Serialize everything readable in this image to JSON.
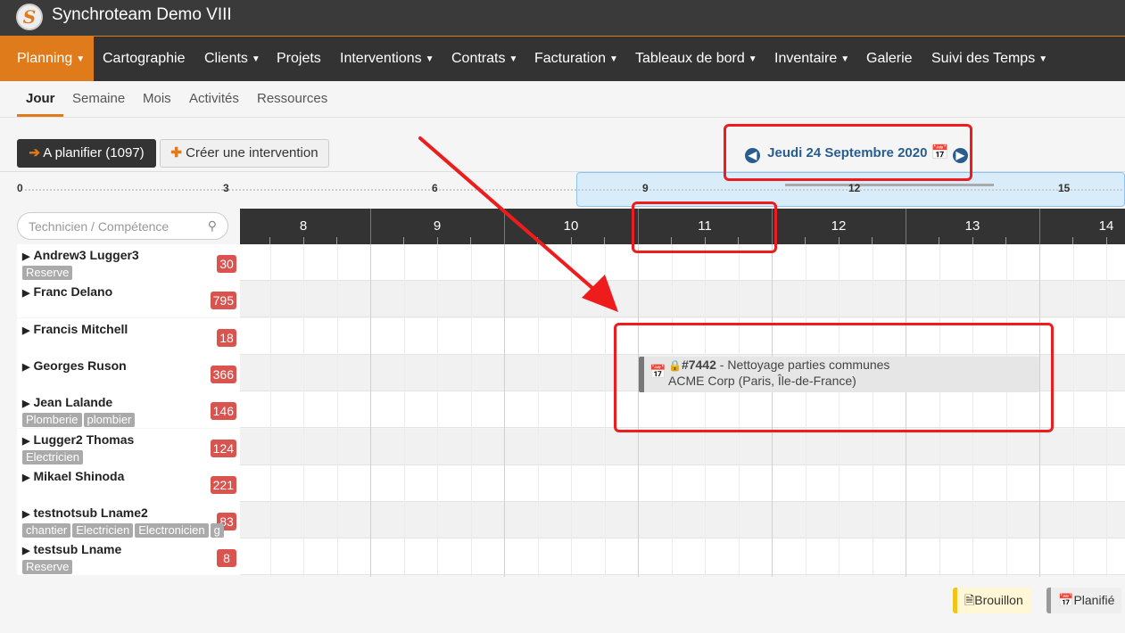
{
  "app": {
    "title": "Synchroteam Demo VIII",
    "logo_letter": "S"
  },
  "menu": [
    {
      "label": "Planning",
      "dropdown": true,
      "active": true
    },
    {
      "label": "Cartographie",
      "dropdown": false
    },
    {
      "label": "Clients",
      "dropdown": true
    },
    {
      "label": "Projets",
      "dropdown": false
    },
    {
      "label": "Interventions",
      "dropdown": true
    },
    {
      "label": "Contrats",
      "dropdown": true
    },
    {
      "label": "Facturation",
      "dropdown": true
    },
    {
      "label": "Tableaux de bord",
      "dropdown": true
    },
    {
      "label": "Inventaire",
      "dropdown": true
    },
    {
      "label": "Galerie",
      "dropdown": false
    },
    {
      "label": "Suivi des Temps",
      "dropdown": true
    }
  ],
  "subtabs": [
    "Jour",
    "Semaine",
    "Mois",
    "Activités",
    "Ressources"
  ],
  "toolbar": {
    "to_plan_label": "A planifier (1097)",
    "create_label": "Créer une intervention"
  },
  "date_nav": {
    "date_label": "Jeudi 24 Septembre 2020"
  },
  "ruler": {
    "labels": [
      "0",
      "3",
      "6",
      "9",
      "12",
      "15"
    ]
  },
  "search": {
    "placeholder": "Technicien / Compétence",
    "value": ""
  },
  "hours": [
    "8",
    "9",
    "10",
    "11",
    "12",
    "13",
    "14"
  ],
  "resources": [
    {
      "name": "Andrew3 Lugger3",
      "count": "30",
      "tags": [
        "Reserve"
      ]
    },
    {
      "name": "Franc Delano",
      "count": "795",
      "tags": []
    },
    {
      "name": "Francis Mitchell",
      "count": "18",
      "tags": []
    },
    {
      "name": "Georges Ruson",
      "count": "366",
      "tags": []
    },
    {
      "name": "Jean Lalande",
      "count": "146",
      "tags": [
        "Plomberie",
        "plombier"
      ]
    },
    {
      "name": "Lugger2 Thomas",
      "count": "124",
      "tags": [
        "Electricien"
      ]
    },
    {
      "name": "Mikael Shinoda",
      "count": "221",
      "tags": []
    },
    {
      "name": "testnotsub Lname2",
      "count": "83",
      "tags": [
        "chantier",
        "Electricien",
        "Electronicien",
        "g"
      ]
    },
    {
      "name": "testsub Lname",
      "count": "8",
      "tags": [
        "Reserve"
      ]
    }
  ],
  "event": {
    "number": "#7442",
    "title": " - Nettoyage parties communes",
    "client": "ACME Corp (Paris, Île-de-France)"
  },
  "legend": {
    "draft": "Brouillon",
    "planned": "Planifié"
  },
  "colors": {
    "accent": "#e07b1c",
    "nav_blue": "#2a5d8f",
    "badge_red": "#d9534f",
    "annotation_red": "#ee1c1c"
  }
}
